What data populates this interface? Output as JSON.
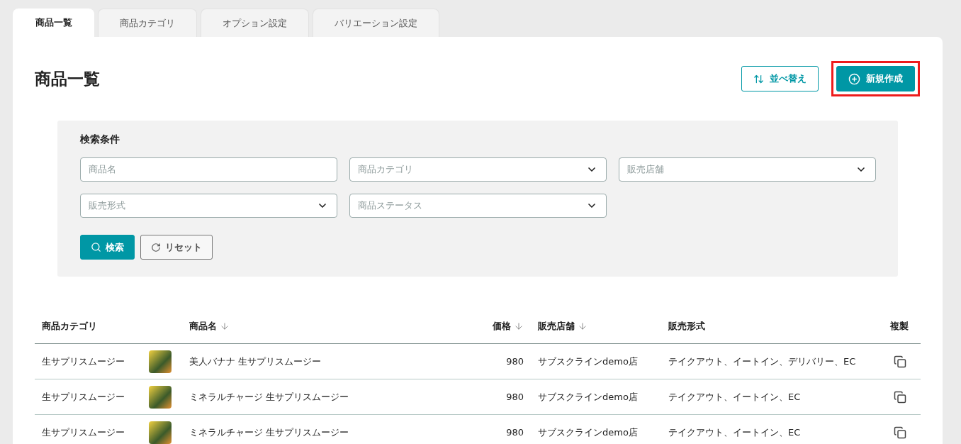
{
  "tabs": [
    {
      "label": "商品一覧",
      "selected": true
    },
    {
      "label": "商品カテゴリ",
      "selected": false
    },
    {
      "label": "オプション設定",
      "selected": false
    },
    {
      "label": "バリエーション設定",
      "selected": false
    }
  ],
  "page_title": "商品一覧",
  "actions": [
    {
      "label": "並べ替え",
      "kind": "sort",
      "highlighted": false
    },
    {
      "label": "新規作成",
      "kind": "create",
      "highlighted": true
    }
  ],
  "search": {
    "title": "検索条件",
    "fields": [
      {
        "placeholder": "商品名",
        "kind": "text"
      },
      {
        "placeholder": "商品カテゴリ",
        "kind": "select"
      },
      {
        "placeholder": "販売店舗",
        "kind": "select"
      },
      {
        "placeholder": "販売形式",
        "kind": "select"
      },
      {
        "placeholder": "商品ステータス",
        "kind": "select"
      }
    ],
    "buttons": [
      {
        "label": "検索",
        "kind": "search"
      },
      {
        "label": "リセット",
        "kind": "reset"
      }
    ]
  },
  "table": {
    "columns": [
      {
        "label": "商品カテゴリ",
        "sortable": false
      },
      {
        "label": "商品名",
        "sortable": true
      },
      {
        "label": "価格",
        "sortable": true
      },
      {
        "label": "販売店舗",
        "sortable": true
      },
      {
        "label": "販売形式",
        "sortable": false
      },
      {
        "label": "複製",
        "sortable": false
      }
    ],
    "rows": [
      {
        "category": "生サプリスムージー",
        "name": "美人バナナ 生サプリスムージー",
        "price": "980",
        "store": "サブスクラインdemo店",
        "format": "テイクアウト、イートイン、デリバリー、EC"
      },
      {
        "category": "生サプリスムージー",
        "name": "ミネラルチャージ 生サプリスムージー",
        "price": "980",
        "store": "サブスクラインdemo店",
        "format": "テイクアウト、イートイン、EC"
      },
      {
        "category": "生サプリスムージー",
        "name": "ミネラルチャージ 生サプリスムージー",
        "price": "980",
        "store": "サブスクラインdemo店",
        "format": "テイクアウト、イートイン、EC"
      }
    ]
  }
}
